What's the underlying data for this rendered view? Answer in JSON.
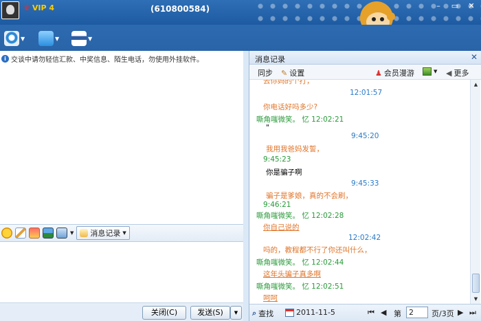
{
  "titlebar": {
    "vip": "VIP 4",
    "qq_number": "(610800584)"
  },
  "notice": "交谈中请勿轻信汇款、中奖信息、陌生电话，勿使用外挂软件。",
  "input_toolbar": {
    "msg_record": "消息记录"
  },
  "buttons": {
    "close": "关闭(C)",
    "send": "发送(S)"
  },
  "record": {
    "title": "消息记录",
    "tools": {
      "sync": "同步",
      "settings": "设置",
      "member_roam": "会员漫游",
      "more": "更多"
    },
    "messages": [
      {
        "kind": "orange",
        "text": "去你妈的个打，"
      },
      {
        "kind": "time",
        "text": "12:01:57"
      },
      {
        "kind": "orange",
        "text": "你电话好吗多少?"
      },
      {
        "kind": "sender",
        "text": "嘶角嗤微笑。 忆 12:02:21"
      },
      {
        "kind": "dark",
        "text": "\""
      },
      {
        "kind": "time",
        "text": "9:45:20"
      },
      {
        "kind": "orange",
        "text": "我用我爸妈发誓，"
      },
      {
        "kind": "sender",
        "text": "9:45:23"
      },
      {
        "kind": "dark",
        "text": "你是骗子啊"
      },
      {
        "kind": "time",
        "text": "9:45:33"
      },
      {
        "kind": "orange",
        "text": "骗子是爹娘，真的不会刷，"
      },
      {
        "kind": "sender",
        "text": "9:46:21"
      },
      {
        "kind": "sender",
        "text": "嘶角嗤微笑。 忆 12:02:28"
      },
      {
        "kind": "underline",
        "text": "你自己说的"
      },
      {
        "kind": "time",
        "text": "12:02:42"
      },
      {
        "kind": "orange",
        "text": "吗的，教程都不行了你还叫什么，"
      },
      {
        "kind": "sender",
        "text": "嘶角嗤微笑。 忆 12:02:44"
      },
      {
        "kind": "underline",
        "text": "这年头骗子真多啊"
      },
      {
        "kind": "sender",
        "text": "嘶角嗤微笑。 忆 12:02:51"
      },
      {
        "kind": "underline",
        "text": "呵呵"
      }
    ],
    "footer": {
      "find": "查找",
      "date": "2011-11-5",
      "page_label": "第",
      "page_value": "2",
      "page_total": "页/3页"
    }
  },
  "colors": {
    "time": "#2a7ac7",
    "sender": "#2a9a3a",
    "orange": "#e0752a",
    "titlebar": "#2a64a8"
  },
  "icons": [
    "camera-icon",
    "folder-icon",
    "tools-icon",
    "smile-icon",
    "edit-icon",
    "image-icon",
    "chart-icon",
    "screen-icon",
    "wrench-icon",
    "user-icon",
    "speaker-icon"
  ]
}
